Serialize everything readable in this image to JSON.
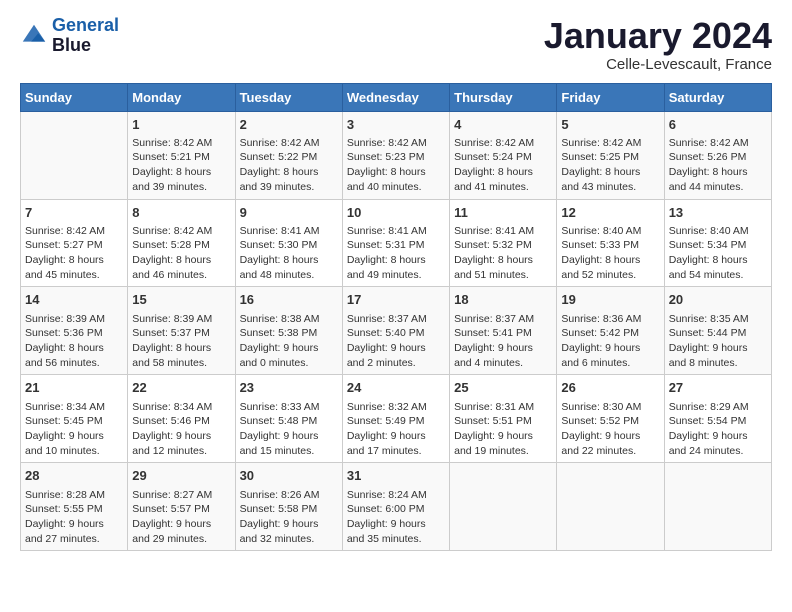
{
  "header": {
    "logo_line1": "General",
    "logo_line2": "Blue",
    "title": "January 2024",
    "subtitle": "Celle-Levescault, France"
  },
  "days_of_week": [
    "Sunday",
    "Monday",
    "Tuesday",
    "Wednesday",
    "Thursday",
    "Friday",
    "Saturday"
  ],
  "weeks": [
    [
      {
        "day": "",
        "content": ""
      },
      {
        "day": "1",
        "content": "Sunrise: 8:42 AM\nSunset: 5:21 PM\nDaylight: 8 hours\nand 39 minutes."
      },
      {
        "day": "2",
        "content": "Sunrise: 8:42 AM\nSunset: 5:22 PM\nDaylight: 8 hours\nand 39 minutes."
      },
      {
        "day": "3",
        "content": "Sunrise: 8:42 AM\nSunset: 5:23 PM\nDaylight: 8 hours\nand 40 minutes."
      },
      {
        "day": "4",
        "content": "Sunrise: 8:42 AM\nSunset: 5:24 PM\nDaylight: 8 hours\nand 41 minutes."
      },
      {
        "day": "5",
        "content": "Sunrise: 8:42 AM\nSunset: 5:25 PM\nDaylight: 8 hours\nand 43 minutes."
      },
      {
        "day": "6",
        "content": "Sunrise: 8:42 AM\nSunset: 5:26 PM\nDaylight: 8 hours\nand 44 minutes."
      }
    ],
    [
      {
        "day": "7",
        "content": "Sunrise: 8:42 AM\nSunset: 5:27 PM\nDaylight: 8 hours\nand 45 minutes."
      },
      {
        "day": "8",
        "content": "Sunrise: 8:42 AM\nSunset: 5:28 PM\nDaylight: 8 hours\nand 46 minutes."
      },
      {
        "day": "9",
        "content": "Sunrise: 8:41 AM\nSunset: 5:30 PM\nDaylight: 8 hours\nand 48 minutes."
      },
      {
        "day": "10",
        "content": "Sunrise: 8:41 AM\nSunset: 5:31 PM\nDaylight: 8 hours\nand 49 minutes."
      },
      {
        "day": "11",
        "content": "Sunrise: 8:41 AM\nSunset: 5:32 PM\nDaylight: 8 hours\nand 51 minutes."
      },
      {
        "day": "12",
        "content": "Sunrise: 8:40 AM\nSunset: 5:33 PM\nDaylight: 8 hours\nand 52 minutes."
      },
      {
        "day": "13",
        "content": "Sunrise: 8:40 AM\nSunset: 5:34 PM\nDaylight: 8 hours\nand 54 minutes."
      }
    ],
    [
      {
        "day": "14",
        "content": "Sunrise: 8:39 AM\nSunset: 5:36 PM\nDaylight: 8 hours\nand 56 minutes."
      },
      {
        "day": "15",
        "content": "Sunrise: 8:39 AM\nSunset: 5:37 PM\nDaylight: 8 hours\nand 58 minutes."
      },
      {
        "day": "16",
        "content": "Sunrise: 8:38 AM\nSunset: 5:38 PM\nDaylight: 9 hours\nand 0 minutes."
      },
      {
        "day": "17",
        "content": "Sunrise: 8:37 AM\nSunset: 5:40 PM\nDaylight: 9 hours\nand 2 minutes."
      },
      {
        "day": "18",
        "content": "Sunrise: 8:37 AM\nSunset: 5:41 PM\nDaylight: 9 hours\nand 4 minutes."
      },
      {
        "day": "19",
        "content": "Sunrise: 8:36 AM\nSunset: 5:42 PM\nDaylight: 9 hours\nand 6 minutes."
      },
      {
        "day": "20",
        "content": "Sunrise: 8:35 AM\nSunset: 5:44 PM\nDaylight: 9 hours\nand 8 minutes."
      }
    ],
    [
      {
        "day": "21",
        "content": "Sunrise: 8:34 AM\nSunset: 5:45 PM\nDaylight: 9 hours\nand 10 minutes."
      },
      {
        "day": "22",
        "content": "Sunrise: 8:34 AM\nSunset: 5:46 PM\nDaylight: 9 hours\nand 12 minutes."
      },
      {
        "day": "23",
        "content": "Sunrise: 8:33 AM\nSunset: 5:48 PM\nDaylight: 9 hours\nand 15 minutes."
      },
      {
        "day": "24",
        "content": "Sunrise: 8:32 AM\nSunset: 5:49 PM\nDaylight: 9 hours\nand 17 minutes."
      },
      {
        "day": "25",
        "content": "Sunrise: 8:31 AM\nSunset: 5:51 PM\nDaylight: 9 hours\nand 19 minutes."
      },
      {
        "day": "26",
        "content": "Sunrise: 8:30 AM\nSunset: 5:52 PM\nDaylight: 9 hours\nand 22 minutes."
      },
      {
        "day": "27",
        "content": "Sunrise: 8:29 AM\nSunset: 5:54 PM\nDaylight: 9 hours\nand 24 minutes."
      }
    ],
    [
      {
        "day": "28",
        "content": "Sunrise: 8:28 AM\nSunset: 5:55 PM\nDaylight: 9 hours\nand 27 minutes."
      },
      {
        "day": "29",
        "content": "Sunrise: 8:27 AM\nSunset: 5:57 PM\nDaylight: 9 hours\nand 29 minutes."
      },
      {
        "day": "30",
        "content": "Sunrise: 8:26 AM\nSunset: 5:58 PM\nDaylight: 9 hours\nand 32 minutes."
      },
      {
        "day": "31",
        "content": "Sunrise: 8:24 AM\nSunset: 6:00 PM\nDaylight: 9 hours\nand 35 minutes."
      },
      {
        "day": "",
        "content": ""
      },
      {
        "day": "",
        "content": ""
      },
      {
        "day": "",
        "content": ""
      }
    ]
  ]
}
